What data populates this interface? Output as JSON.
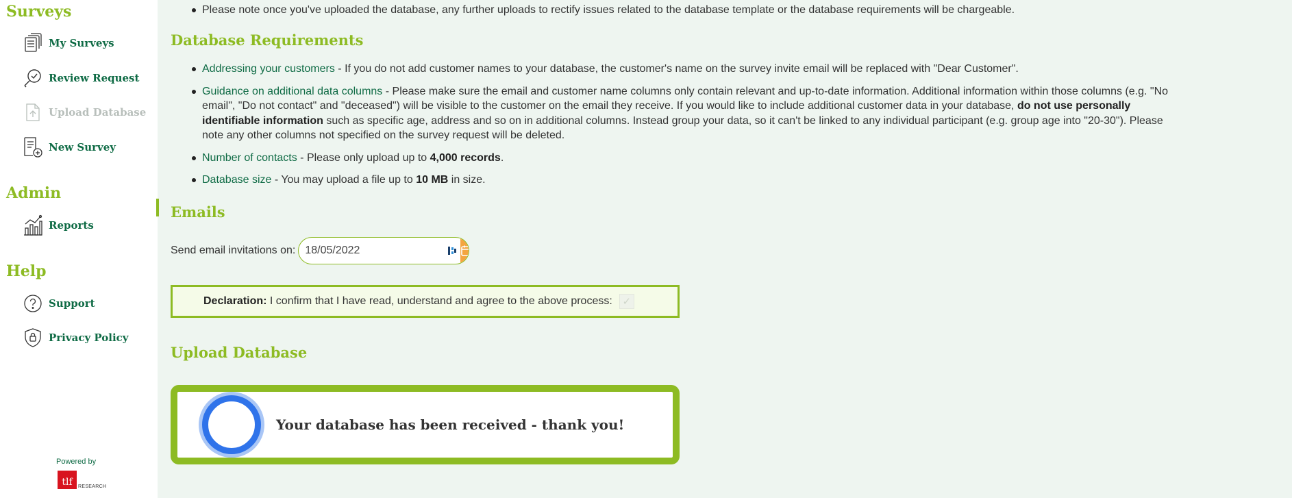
{
  "sidebar": {
    "sections": {
      "surveys": "Surveys",
      "admin": "Admin",
      "help": "Help"
    },
    "items": {
      "my_surveys": "My Surveys",
      "review_request": "Review Request",
      "upload_database": "Upload Database",
      "new_survey": "New Survey",
      "reports": "Reports",
      "support": "Support",
      "privacy_policy": "Privacy Policy"
    },
    "powered_by": "Powered by",
    "logo": {
      "mark": "tlf",
      "word": "RESEARCH"
    }
  },
  "main": {
    "top_note": "Please note once you've uploaded the database, any further uploads to rectify issues related to the database template or the database requirements will be chargeable.",
    "requirements_title": "Database Requirements",
    "requirements": [
      {
        "term": "Addressing your customers",
        "text": " - If you do not add customer names to your database, the customer's name on the survey invite email will be replaced with \"Dear Customer\"."
      },
      {
        "term": "Guidance on additional data columns",
        "text_a": " - Please make sure the email and customer name columns only contain relevant and up-to-date information. Additional information within those columns (e.g. \"No email\", \"Do not contact\" and \"deceased\") will be visible to the customer on the email they receive. If you would like to include additional customer data in your database, ",
        "bold": "do not use personally identifiable information",
        "text_b": " such as specific age, address and so on in additional columns. Instead group your data, so it can't be linked to any individual participant (e.g. group age into \"20-30\"). Please note any other columns not specified on the survey request will be deleted."
      },
      {
        "term": "Number of contacts",
        "text_a": " - Please only upload up to ",
        "bold": "4,000 records",
        "text_b": "."
      },
      {
        "term": "Database size",
        "text_a": " - You may upload a file up to ",
        "bold": "10 MB",
        "text_b": " in size."
      }
    ],
    "emails_title": "Emails",
    "send_label": "Send email invitations on:",
    "send_date": "18/05/2022",
    "declaration_label": "Declaration:",
    "declaration_text": " I confirm that I have read, understand and agree to the above process:",
    "declaration_checked": true,
    "upload_title": "Upload Database",
    "upload_message": "Your database has been received - thank you!"
  },
  "colors": {
    "accent": "#8dbb23",
    "link": "#0f6b45",
    "calendar_button": "#f4a541",
    "spinner": "#2f73ea"
  }
}
